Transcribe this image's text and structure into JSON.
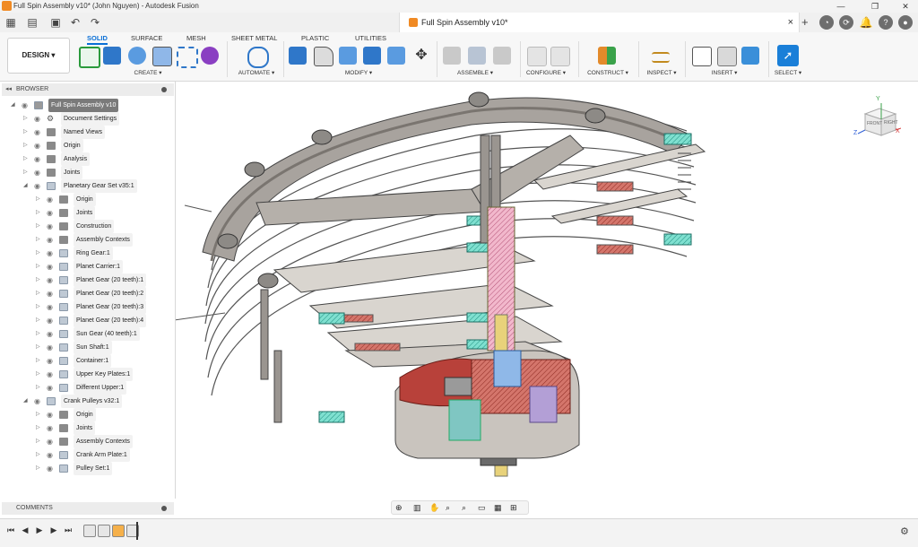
{
  "window": {
    "title": "Full Spin Assembly v10* (John Nguyen) - Autodesk Fusion",
    "controls": [
      "minimize-icon",
      "maximize-icon",
      "close-icon"
    ]
  },
  "tabbar": {
    "document_tab": "Full Spin Assembly v10*",
    "close_glyph": "×",
    "right_buttons": [
      "plus-icon",
      "job-status-icon",
      "notifications-icon",
      "help-icon",
      "user-avatar"
    ]
  },
  "ribbon": {
    "workspace": "DESIGN",
    "tabs": [
      "SOLID",
      "SURFACE",
      "MESH",
      "SHEET METAL",
      "PLASTIC",
      "UTILITIES"
    ],
    "active_tab": "SOLID",
    "groups": [
      "CREATE ▾",
      "AUTOMATE ▾",
      "MODIFY ▾",
      "ASSEMBLE ▾",
      "CONFIGURE ▾",
      "CONSTRUCT ▾",
      "INSPECT ▾",
      "INSERT ▾",
      "SELECT ▾"
    ]
  },
  "browser": {
    "header": "BROWSER",
    "items": [
      {
        "label": "Full Spin Assembly v10",
        "depth": 0,
        "type": "root",
        "expanded": true
      },
      {
        "label": "Document Settings",
        "depth": 1,
        "type": "settings"
      },
      {
        "label": "Named Views",
        "depth": 1,
        "type": "folder"
      },
      {
        "label": "Origin",
        "depth": 1,
        "type": "folder"
      },
      {
        "label": "Analysis",
        "depth": 1,
        "type": "folder"
      },
      {
        "label": "Joints",
        "depth": 1,
        "type": "folder"
      },
      {
        "label": "Planetary Gear Set v35:1",
        "depth": 1,
        "type": "component",
        "expanded": true
      },
      {
        "label": "Origin",
        "depth": 2,
        "type": "folder"
      },
      {
        "label": "Joints",
        "depth": 2,
        "type": "folder"
      },
      {
        "label": "Construction",
        "depth": 2,
        "type": "folder"
      },
      {
        "label": "Assembly Contexts",
        "depth": 2,
        "type": "folder"
      },
      {
        "label": "Ring Gear:1",
        "depth": 2,
        "type": "component"
      },
      {
        "label": "Planet Carrier:1",
        "depth": 2,
        "type": "component"
      },
      {
        "label": "Planet Gear (20 teeth):1",
        "depth": 2,
        "type": "component"
      },
      {
        "label": "Planet Gear (20 teeth):2",
        "depth": 2,
        "type": "component"
      },
      {
        "label": "Planet Gear (20 teeth):3",
        "depth": 2,
        "type": "component"
      },
      {
        "label": "Planet Gear (20 teeth):4",
        "depth": 2,
        "type": "component"
      },
      {
        "label": "Sun Gear (40 teeth):1",
        "depth": 2,
        "type": "component"
      },
      {
        "label": "Sun Shaft:1",
        "depth": 2,
        "type": "component"
      },
      {
        "label": "Container:1",
        "depth": 2,
        "type": "component"
      },
      {
        "label": "Upper Key Plates:1",
        "depth": 2,
        "type": "component"
      },
      {
        "label": "Different Upper:1",
        "depth": 2,
        "type": "component"
      },
      {
        "label": "Crank Pulleys v32:1",
        "depth": 1,
        "type": "component",
        "expanded": true
      },
      {
        "label": "Origin",
        "depth": 2,
        "type": "folder"
      },
      {
        "label": "Joints",
        "depth": 2,
        "type": "folder"
      },
      {
        "label": "Assembly Contexts",
        "depth": 2,
        "type": "folder"
      },
      {
        "label": "Crank Arm Plate:1",
        "depth": 2,
        "type": "component"
      },
      {
        "label": "Pulley Set:1",
        "depth": 2,
        "type": "component"
      }
    ]
  },
  "comments": {
    "header": "COMMENTS"
  },
  "viewcube": {
    "front": "FRONT",
    "right": "RIGHT",
    "axis_x": "X",
    "axis_y": "Y",
    "axis_z": "Z"
  },
  "colors": {
    "accent": "#0a6fd6",
    "part_gray": "#bdb8b2",
    "section_red": "#c0392b",
    "section_teal": "#3cc8b4",
    "section_pink": "#e89ab5"
  }
}
